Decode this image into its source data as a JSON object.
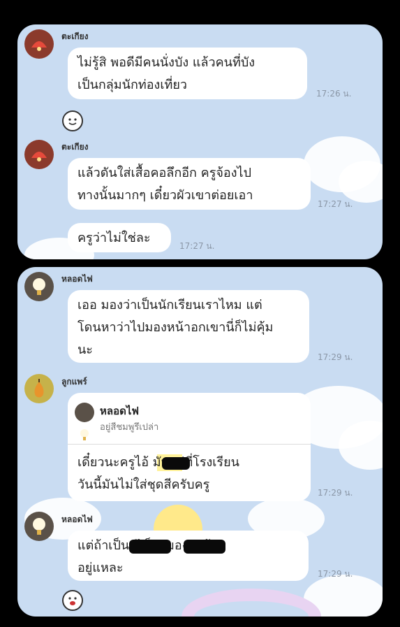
{
  "screens": {
    "top": {
      "messages": [
        {
          "sender": "ตะเกียง",
          "text": "ไม่รู้สิ พอดีมีคนนั่งบัง แล้วคนที่บัง\nเป็นกลุ่มนักท่องเที่ยว",
          "time": "17:26 น."
        },
        {
          "sender": "ตะเกียง",
          "text": "แล้วดันใส่เสื้อคอลึกอีก ครูจ้องไป\nทางนั้นมากๆ เดี๋ยวผัวเขาต่อยเอา",
          "time": "17:27 น."
        },
        {
          "sender": "",
          "text": "ครูว่าไม่ใช่ละ",
          "time": "17:27 น."
        }
      ]
    },
    "bottom": {
      "messages": [
        {
          "sender": "หลอดไฟ",
          "text": "เออ มองว่าเป็นนักเรียนเราไหม แต่\nโดนหาว่าไปมองหน้าอกเขานี่ก็ไม่คุ้ม\nนะ",
          "time": "17:29 น."
        },
        {
          "sender": "ลูกแพร์",
          "reply_name": "หลอดไฟ",
          "reply_sub": "อยู่สีชมพูรึเปล่า",
          "text": "เดี๋ยวนะครูไอ้     มันอยู่ที่โรงเรียน\nวันนี้มันไม่ใส่ชุดสีครับครู",
          "time": "17:29 น."
        },
        {
          "sender": "หลอดไฟ",
          "text": "แต่ถ้าเป็น          รึ          ก็คงมองว่าคุ้ม\nอยู่แหละ",
          "time": "17:29 น."
        }
      ]
    }
  },
  "colors": {
    "chat_bg": "#c9dcf2",
    "bubble": "#ffffff",
    "outer": "#000000"
  },
  "icons": [
    "lamp-avatar-icon",
    "bulb-avatar-icon",
    "pear-avatar-icon",
    "sticker-icon"
  ]
}
